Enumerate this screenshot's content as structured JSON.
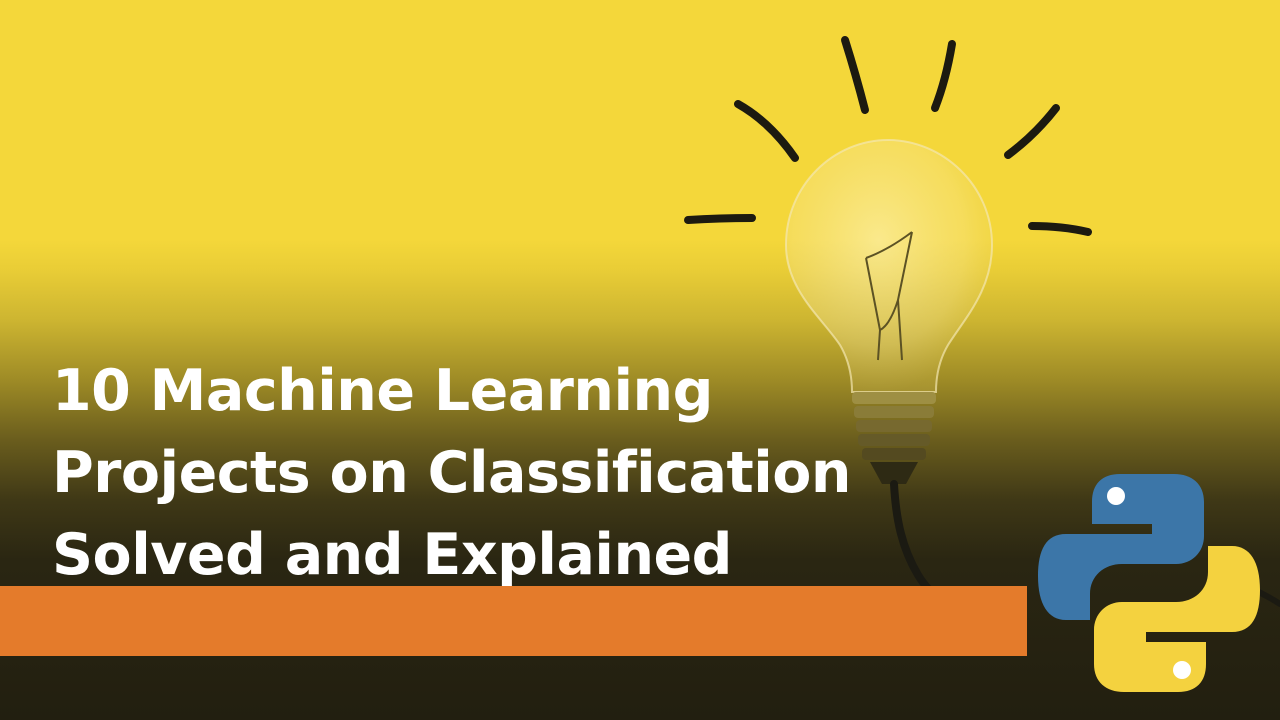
{
  "title": {
    "lines": [
      "10 Machine Learning",
      "Projects on Classification",
      "Solved and Explained"
    ]
  },
  "colors": {
    "background": "#f4d73a",
    "accent_bar": "#e47b2b",
    "title_text": "#ffffff",
    "python_blue": "#3c76a8",
    "python_yellow": "#f4d23f"
  },
  "images": {
    "bulb": "light-bulb-icon",
    "logo": "python-logo-icon"
  }
}
